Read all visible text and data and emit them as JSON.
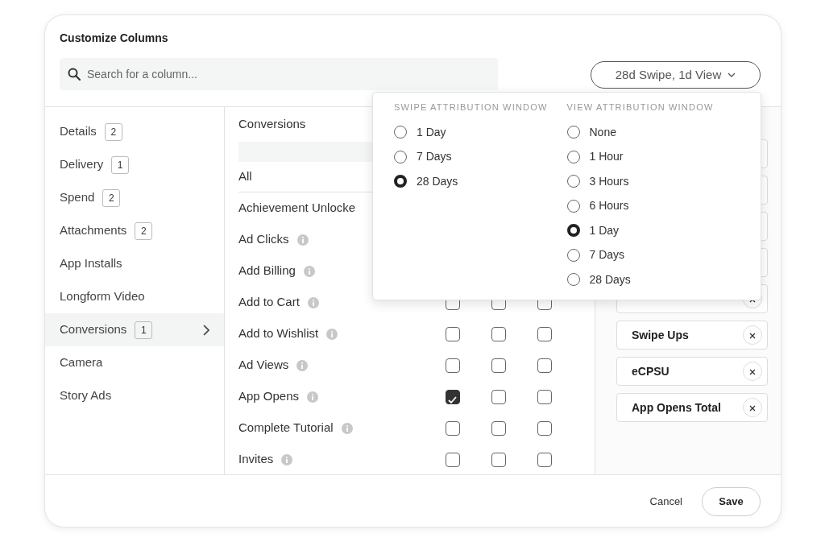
{
  "dialog": {
    "title": "Customize Columns"
  },
  "search": {
    "placeholder": "Search for a column..."
  },
  "attribution_button": {
    "label": "28d Swipe, 1d View",
    "expanded": true
  },
  "attribution_menu": {
    "groups": [
      {
        "heading": "SWIPE ATTRIBUTION WINDOW",
        "options": [
          {
            "label": "1 Day",
            "selected": false
          },
          {
            "label": "7 Days",
            "selected": false
          },
          {
            "label": "28 Days",
            "selected": true
          }
        ]
      },
      {
        "heading": "VIEW ATTRIBUTION WINDOW",
        "options": [
          {
            "label": "None",
            "selected": false
          },
          {
            "label": "1 Hour",
            "selected": false
          },
          {
            "label": "3 Hours",
            "selected": false
          },
          {
            "label": "6 Hours",
            "selected": false
          },
          {
            "label": "1 Day",
            "selected": true
          },
          {
            "label": "7 Days",
            "selected": false
          },
          {
            "label": "28 Days",
            "selected": false
          }
        ]
      }
    ]
  },
  "categories": [
    {
      "label": "Details",
      "count": "2",
      "selected": false
    },
    {
      "label": "Delivery",
      "count": "1",
      "selected": false
    },
    {
      "label": "Spend",
      "count": "2",
      "selected": false
    },
    {
      "label": "Attachments",
      "count": "2",
      "selected": false
    },
    {
      "label": "App Installs",
      "selected": false
    },
    {
      "label": "Longform Video",
      "selected": false
    },
    {
      "label": "Conversions",
      "count": "1",
      "selected": true
    },
    {
      "label": "Camera",
      "selected": false
    },
    {
      "label": "Story Ads",
      "selected": false
    }
  ],
  "columns_panel": {
    "heading": "Conversions",
    "all_label": "All",
    "rows": [
      {
        "label": "Achievement Unlocke",
        "info": false
      },
      {
        "label": "Ad Clicks",
        "info": true
      },
      {
        "label": "Add Billing",
        "info": true
      },
      {
        "label": "Add to Cart",
        "info": true,
        "checks": [
          false,
          false,
          false
        ]
      },
      {
        "label": "Add to Wishlist",
        "info": true,
        "checks": [
          false,
          false,
          false
        ]
      },
      {
        "label": "Ad Views",
        "info": true,
        "checks": [
          false,
          false,
          false
        ]
      },
      {
        "label": "App Opens",
        "info": true,
        "checks": [
          true,
          false,
          false
        ]
      },
      {
        "label": "Complete Tutorial",
        "info": true,
        "checks": [
          false,
          false,
          false
        ]
      },
      {
        "label": "Invites",
        "info": true,
        "checks": [
          false,
          false,
          false
        ]
      }
    ]
  },
  "selected_columns": [
    {
      "kind": "covered"
    },
    {
      "kind": "covered"
    },
    {
      "kind": "covered"
    },
    {
      "kind": "covered"
    },
    {
      "kind": "cut"
    },
    {
      "kind": "chip",
      "label": "Swipe Ups"
    },
    {
      "kind": "chip",
      "label": "eCPSU"
    },
    {
      "kind": "chip",
      "label": "App Opens Total"
    }
  ],
  "footer": {
    "cancel": "Cancel",
    "save": "Save"
  }
}
